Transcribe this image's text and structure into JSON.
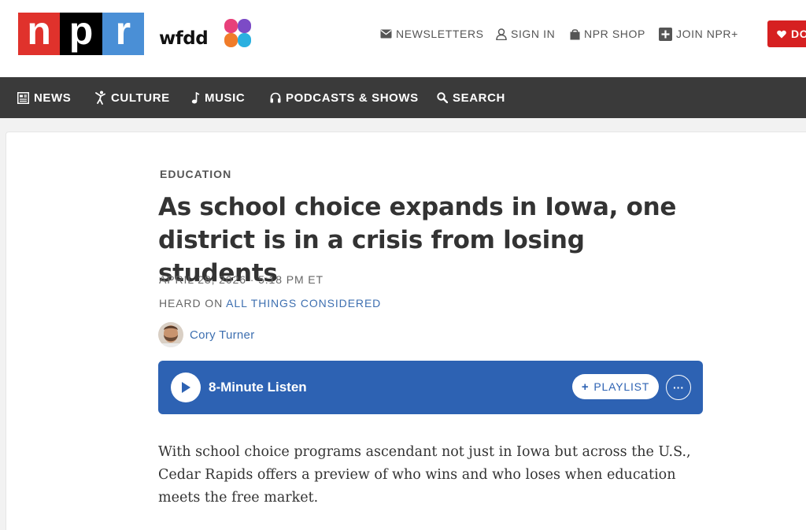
{
  "header": {
    "npr_logo": [
      "n",
      "p",
      "r"
    ],
    "station": "wfdd",
    "utility_links": {
      "newsletters": "NEWSLETTERS",
      "sign_in": "SIGN IN",
      "shop": "NPR SHOP",
      "join": "JOIN NPR+"
    },
    "donate": "DO"
  },
  "nav": {
    "news": "NEWS",
    "culture": "CULTURE",
    "music": "MUSIC",
    "podcasts": "PODCASTS & SHOWS",
    "search": "SEARCH"
  },
  "article": {
    "slug": "EDUCATION",
    "headline": "As school choice expands in Iowa, one district is in a crisis from losing students",
    "dateline": "APRIL 28, 2026 · 5:18 PM ET",
    "heard_on_prefix": "HEARD ON",
    "heard_on_show": "ALL THINGS CONSIDERED",
    "author": "Cory Turner",
    "audio": {
      "listen_label": "8-Minute Listen",
      "playlist_label": "PLAYLIST",
      "more_label": "···"
    },
    "teaser": "With school choice programs ascendant not just in Iowa but across the U.S., Cedar Rapids offers a preview of who wins and who loses when education meets the free market."
  },
  "colors": {
    "npr_red": "#e0322c",
    "npr_blue": "#4a8fd6",
    "nav_bg": "#3a3a3a",
    "player_bg": "#2d62b3",
    "link": "#3d6fb0",
    "donate": "#d62021"
  },
  "icons": {
    "newsletters": "envelope-icon",
    "sign_in": "user-icon",
    "shop": "bag-icon",
    "join": "plus-square-icon",
    "donate": "heart-icon",
    "news": "newspaper-icon",
    "culture": "dancer-icon",
    "music": "music-note-icon",
    "podcasts": "headphones-icon",
    "search": "search-icon",
    "play": "play-icon"
  }
}
